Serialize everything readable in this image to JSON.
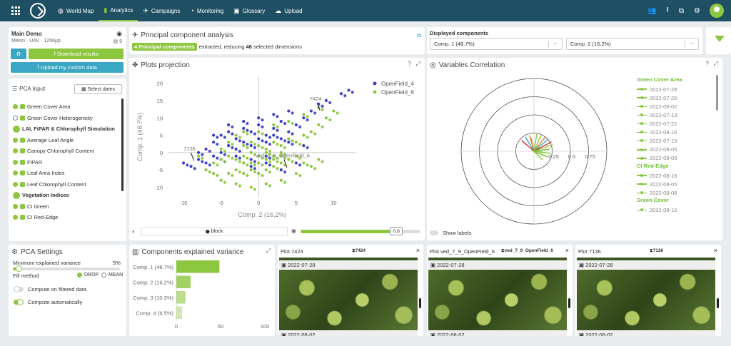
{
  "nav": {
    "items": [
      {
        "label": "World Map",
        "icon": "globe-icon"
      },
      {
        "label": "Analytics",
        "icon": "bar-chart-icon",
        "active": true
      },
      {
        "label": "Campaigns",
        "icon": "plane-icon"
      },
      {
        "label": "Monitoring",
        "icon": "pie-icon"
      },
      {
        "label": "Glossary",
        "icon": "book-icon"
      },
      {
        "label": "Upload",
        "icon": "cloud-upload-icon"
      }
    ]
  },
  "project": {
    "title": "Main Demo",
    "subtitle": "Melon · UAV · 1256μp",
    "count": "9",
    "download_label": "Download results",
    "upload_label": "Upload my custom data"
  },
  "pca_input": {
    "title": "PCA Input",
    "select_dates_label": "Select dates",
    "items": [
      {
        "label": "Green Cover Area",
        "type": "item",
        "checked": true
      },
      {
        "label": "Green Cover Heterogeneity",
        "type": "item",
        "checked": false
      },
      {
        "label": "LAI, FiPAR & Chlorophyll Simulation",
        "type": "group"
      },
      {
        "label": "Average Leaf Angle",
        "type": "item",
        "checked": true
      },
      {
        "label": "Canopy Chlorophyll Content",
        "type": "item",
        "checked": true
      },
      {
        "label": "FiPAR",
        "type": "item",
        "checked": true
      },
      {
        "label": "Leaf Area Index",
        "type": "item",
        "checked": true
      },
      {
        "label": "Leaf Chlorophyll Content",
        "type": "item",
        "checked": true
      },
      {
        "label": "Vegetation Indices",
        "type": "group"
      },
      {
        "label": "CI Green",
        "type": "item",
        "checked": true
      },
      {
        "label": "CI Red-Edge",
        "type": "item",
        "checked": true
      }
    ]
  },
  "pca_settings": {
    "title": "PCA Settings",
    "min_var_label": "Minimum explained variance",
    "min_var_value": "5%",
    "min_var_fraction": 0.05,
    "fill_label": "Fill method",
    "fill_drop": "DROP",
    "fill_mean": "MEAN",
    "filtered_label": "Compute on filtered data",
    "auto_label": "Compute automatically"
  },
  "pca_header": {
    "title": "Principal component analysis",
    "badge": "4 Principal components",
    "text_a": "extracted, reducing",
    "dims": "48",
    "text_b": "selected dimensions"
  },
  "displayed": {
    "title": "Displayed components",
    "comp_a": "Comp. 1 (48.7%)",
    "comp_b": "Comp. 2 (16.2%)"
  },
  "projection": {
    "title": "Plots projection",
    "block_label": "block",
    "slider_value": "0.8",
    "slider_fraction": 0.8,
    "annotations": [
      {
        "label": "7424",
        "x": 7.6,
        "y": 15
      },
      {
        "label": "7136",
        "x": -9.2,
        "y": 0.6
      },
      {
        "label": "ved_7_9_OpenField_6",
        "x": 3.2,
        "y": -1.4
      }
    ]
  },
  "correlation": {
    "title": "Variables Correlation",
    "ticks": [
      "0.25",
      "0.5",
      "0.75"
    ],
    "show_labels": "Show labels",
    "legend": [
      {
        "label": "Green Cover Area",
        "type": "group"
      },
      {
        "label": "2022-07-28",
        "type": "item"
      },
      {
        "label": "2022-07-20",
        "type": "item"
      },
      {
        "label": "2022-08-02",
        "type": "item"
      },
      {
        "label": "2022-07-13",
        "type": "item"
      },
      {
        "label": "2022-07-22",
        "type": "item"
      },
      {
        "label": "2022-08-16",
        "type": "item"
      },
      {
        "label": "2022-07-15",
        "type": "item"
      },
      {
        "label": "2022-08-05",
        "type": "item"
      },
      {
        "label": "2022-08-08",
        "type": "item"
      },
      {
        "label": "CI Red-Edge",
        "type": "group"
      },
      {
        "label": "2022-08-16",
        "type": "item"
      },
      {
        "label": "2022-08-05",
        "type": "item"
      },
      {
        "label": "2022-08-08",
        "type": "item"
      },
      {
        "label": "Green Cover",
        "type": "group"
      },
      {
        "label": "2022-08-16",
        "type": "item"
      }
    ]
  },
  "variance": {
    "title": "Components explained variance"
  },
  "plots": [
    {
      "title": "Plot 7424",
      "tag": "7424",
      "date": "2022-07-28",
      "date2": "2022-08-02"
    },
    {
      "title": "Plot ved_7_9_OpenField_6",
      "tag": "ved_7_9_OpenField_6",
      "date": "2022-07-28",
      "date2": "2022-08-02"
    },
    {
      "title": "Plot 7136",
      "tag": "7136",
      "date": "2022-07-28",
      "date2": "2022-08-02"
    }
  ],
  "chart_data": [
    {
      "type": "scatter",
      "xlabel": "Comp. 2 (16,2%)",
      "ylabel": "Comp. 1 (48.7%)",
      "xlim": [
        -12,
        13
      ],
      "ylim": [
        -13,
        22
      ],
      "xticks": [
        -10,
        -5,
        0,
        5,
        10
      ],
      "yticks": [
        -10,
        -5,
        0,
        5,
        10,
        15,
        20
      ],
      "series": [
        {
          "name": "OpenField_4",
          "color": "#3b3fc4",
          "points": [
            [
              -8,
              -2
            ],
            [
              -7,
              1
            ],
            [
              -6,
              3
            ],
            [
              -5,
              5
            ],
            [
              -4,
              6
            ],
            [
              -3,
              4
            ],
            [
              -2,
              7
            ],
            [
              -1,
              6
            ],
            [
              0,
              8
            ],
            [
              1,
              5
            ],
            [
              2,
              7
            ],
            [
              3,
              9
            ],
            [
              4,
              6
            ],
            [
              5,
              8
            ],
            [
              -6,
              -1
            ],
            [
              -5,
              0
            ],
            [
              -4,
              2
            ],
            [
              -3,
              1
            ],
            [
              -2,
              3
            ],
            [
              -1,
              2
            ],
            [
              0,
              4
            ],
            [
              1,
              3
            ],
            [
              2,
              5
            ],
            [
              3,
              4
            ],
            [
              4,
              3
            ],
            [
              -9,
              -4
            ],
            [
              -7,
              -3
            ],
            [
              -5,
              -2
            ],
            [
              -3,
              -1
            ],
            [
              -1,
              -2
            ],
            [
              1,
              -1
            ],
            [
              6,
              10
            ],
            [
              7,
              12
            ],
            [
              8,
              14
            ],
            [
              -2,
              9
            ],
            [
              0,
              10
            ],
            [
              2,
              11
            ],
            [
              4,
              12
            ],
            [
              -4,
              8
            ],
            [
              -6,
              5
            ],
            [
              -8,
              0
            ],
            [
              -10,
              -3
            ],
            [
              9,
              15
            ],
            [
              11,
              17
            ],
            [
              12,
              18
            ],
            [
              -1,
              -4
            ],
            [
              1,
              -3
            ],
            [
              3,
              -5
            ],
            [
              5,
              -3
            ],
            [
              6,
              2
            ]
          ]
        },
        {
          "name": "OpenField_6",
          "color": "#8dc63f",
          "points": [
            [
              -6,
              -3
            ],
            [
              -5,
              -2
            ],
            [
              -4,
              -1
            ],
            [
              -3,
              -2
            ],
            [
              -2,
              -1
            ],
            [
              -1,
              0
            ],
            [
              0,
              -1
            ],
            [
              1,
              0
            ],
            [
              2,
              -1
            ],
            [
              3,
              0
            ],
            [
              4,
              -2
            ],
            [
              5,
              -1
            ],
            [
              6,
              -3
            ],
            [
              -4,
              -6
            ],
            [
              -3,
              -5
            ],
            [
              -2,
              -6
            ],
            [
              -1,
              -5
            ],
            [
              0,
              -6
            ],
            [
              1,
              -5
            ],
            [
              2,
              -4
            ],
            [
              3,
              -3
            ],
            [
              -2,
              2
            ],
            [
              -1,
              3
            ],
            [
              0,
              2
            ],
            [
              1,
              1
            ],
            [
              2,
              3
            ],
            [
              3,
              2
            ],
            [
              4,
              4
            ],
            [
              5,
              3
            ],
            [
              6,
              5
            ],
            [
              7,
              6
            ],
            [
              8,
              8
            ],
            [
              9,
              10
            ],
            [
              10,
              12
            ],
            [
              -5,
              1
            ],
            [
              -4,
              3
            ],
            [
              -3,
              5
            ],
            [
              -2,
              6
            ],
            [
              0,
              6
            ],
            [
              2,
              8
            ],
            [
              4,
              9
            ],
            [
              6,
              11
            ],
            [
              8,
              13
            ],
            [
              -6,
              -6
            ],
            [
              -5,
              -8
            ],
            [
              -3,
              -9
            ],
            [
              -1,
              -10
            ],
            [
              1,
              -9
            ],
            [
              3,
              -8
            ],
            [
              5,
              -6
            ],
            [
              7,
              -4
            ],
            [
              8,
              -2
            ],
            [
              -7,
              -5
            ],
            [
              -8,
              -1
            ],
            [
              -1,
              -3
            ],
            [
              0,
              -3
            ],
            [
              1,
              -2
            ],
            [
              2,
              -2
            ],
            [
              3,
              -1
            ],
            [
              -2,
              -3
            ]
          ]
        }
      ]
    },
    {
      "type": "bar",
      "orientation": "horizontal",
      "categories": [
        "Comp. 1 (48.7%)",
        "Comp. 2 (16.2%)",
        "Comp. 3 (10.3%)",
        "Comp. 4 (6.5%)"
      ],
      "values": [
        48.7,
        16.2,
        10.3,
        6.5
      ],
      "xlim": [
        0,
        100
      ],
      "xticks": [
        0,
        50,
        100
      ]
    },
    {
      "type": "line",
      "description": "correlation vectors",
      "vectors": [
        [
          0.1,
          0.22
        ],
        [
          0.16,
          0.2
        ],
        [
          0.2,
          0.17
        ],
        [
          0.24,
          0.13
        ],
        [
          0.26,
          0.09
        ],
        [
          0.22,
          0.03
        ],
        [
          0.24,
          -0.03
        ],
        [
          -0.06,
          0.22
        ],
        [
          -0.12,
          0.2
        ],
        [
          -0.17,
          0.15
        ],
        [
          0.04,
          0.24
        ],
        [
          0.19,
          -0.08
        ],
        [
          0.12,
          -0.12
        ],
        [
          -0.04,
          0.18
        ]
      ],
      "color": "#8dc63f"
    }
  ]
}
